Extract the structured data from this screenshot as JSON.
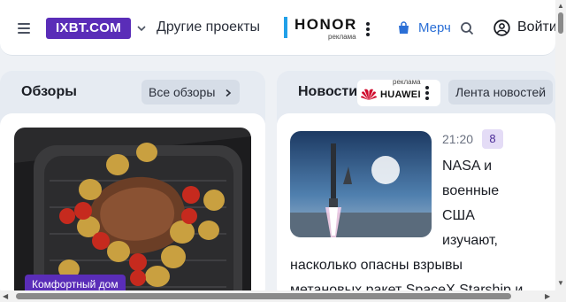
{
  "header": {
    "logo": "IXBT.COM",
    "projects_label": "Другие проекты",
    "honor_brand": "HONOR",
    "honor_ad_label": "реклама",
    "merch_label": "Мерч",
    "login_label": "Войти"
  },
  "reviews": {
    "title": "Обзоры",
    "all_button": "Все обзоры",
    "card_tag": "Комфортный дом"
  },
  "news": {
    "title": "Новости",
    "feed_button": "Лента новостей",
    "ad_label": "реклама",
    "ad_brand": "HUAWEI",
    "item_time": "21:20",
    "item_comments": "8",
    "item_headline_lines": [
      "NASA и",
      "военные",
      "США",
      "изучают,"
    ],
    "item_headline_rest": [
      "насколько опасны взрывы",
      "метановых ракет SpaceX Starship и"
    ]
  },
  "colors": {
    "brand_purple": "#5a2db8",
    "link_blue": "#2b6fd6",
    "honor_accent": "#21a0e8"
  }
}
